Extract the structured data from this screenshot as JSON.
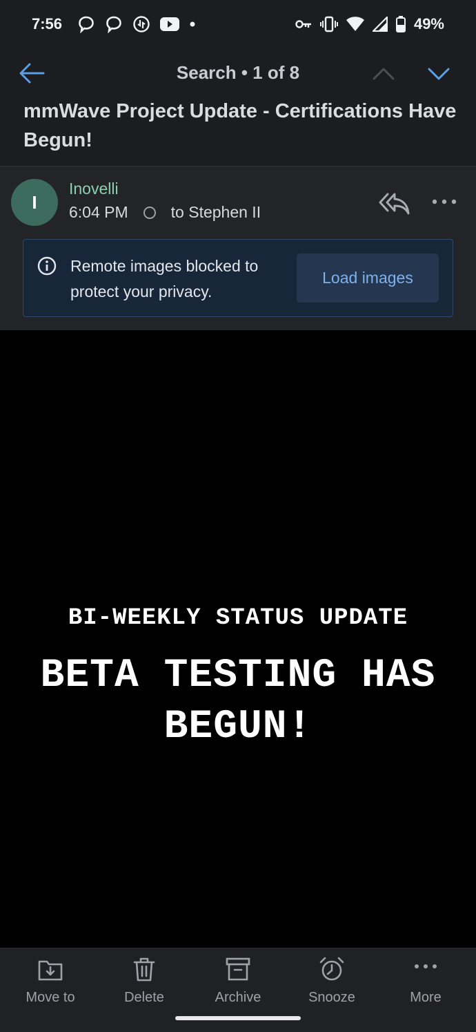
{
  "status_bar": {
    "time": "7:56",
    "battery_percent": "49%",
    "left_icons": [
      "chat-bubble-icon",
      "chat-bubble-icon",
      "signal-app-icon",
      "youtube-icon",
      "dot-icon"
    ],
    "right_icons": [
      "vpn-key-icon",
      "vibrate-icon",
      "wifi-icon",
      "cell-signal-icon",
      "battery-icon"
    ]
  },
  "header": {
    "search_label": "Search • 1 of 8",
    "subject": "mmWave Project Update - Certifications Have Begun!"
  },
  "message": {
    "avatar_initial": "I",
    "avatar_color": "#3d6b5e",
    "sender": "Inovelli",
    "sender_color": "#8fcfb2",
    "time": "6:04 PM",
    "recipient": "to Stephen II"
  },
  "privacy_banner": {
    "text": "Remote images blocked to protect your privacy.",
    "button_label": "Load images"
  },
  "email_body": {
    "kicker": "BI-WEEKLY STATUS UPDATE",
    "headline": "BETA TESTING HAS BEGUN!"
  },
  "toolbar": {
    "items": [
      {
        "label": "Move to",
        "icon": "folder-move-icon"
      },
      {
        "label": "Delete",
        "icon": "trash-icon"
      },
      {
        "label": "Archive",
        "icon": "archive-icon"
      },
      {
        "label": "Snooze",
        "icon": "alarm-clock-icon"
      },
      {
        "label": "More",
        "icon": "more-horizontal-icon"
      }
    ]
  },
  "colors": {
    "accent": "#5b9fe6",
    "header_bg": "#1b1d21",
    "banner_bg": "#18263a"
  }
}
